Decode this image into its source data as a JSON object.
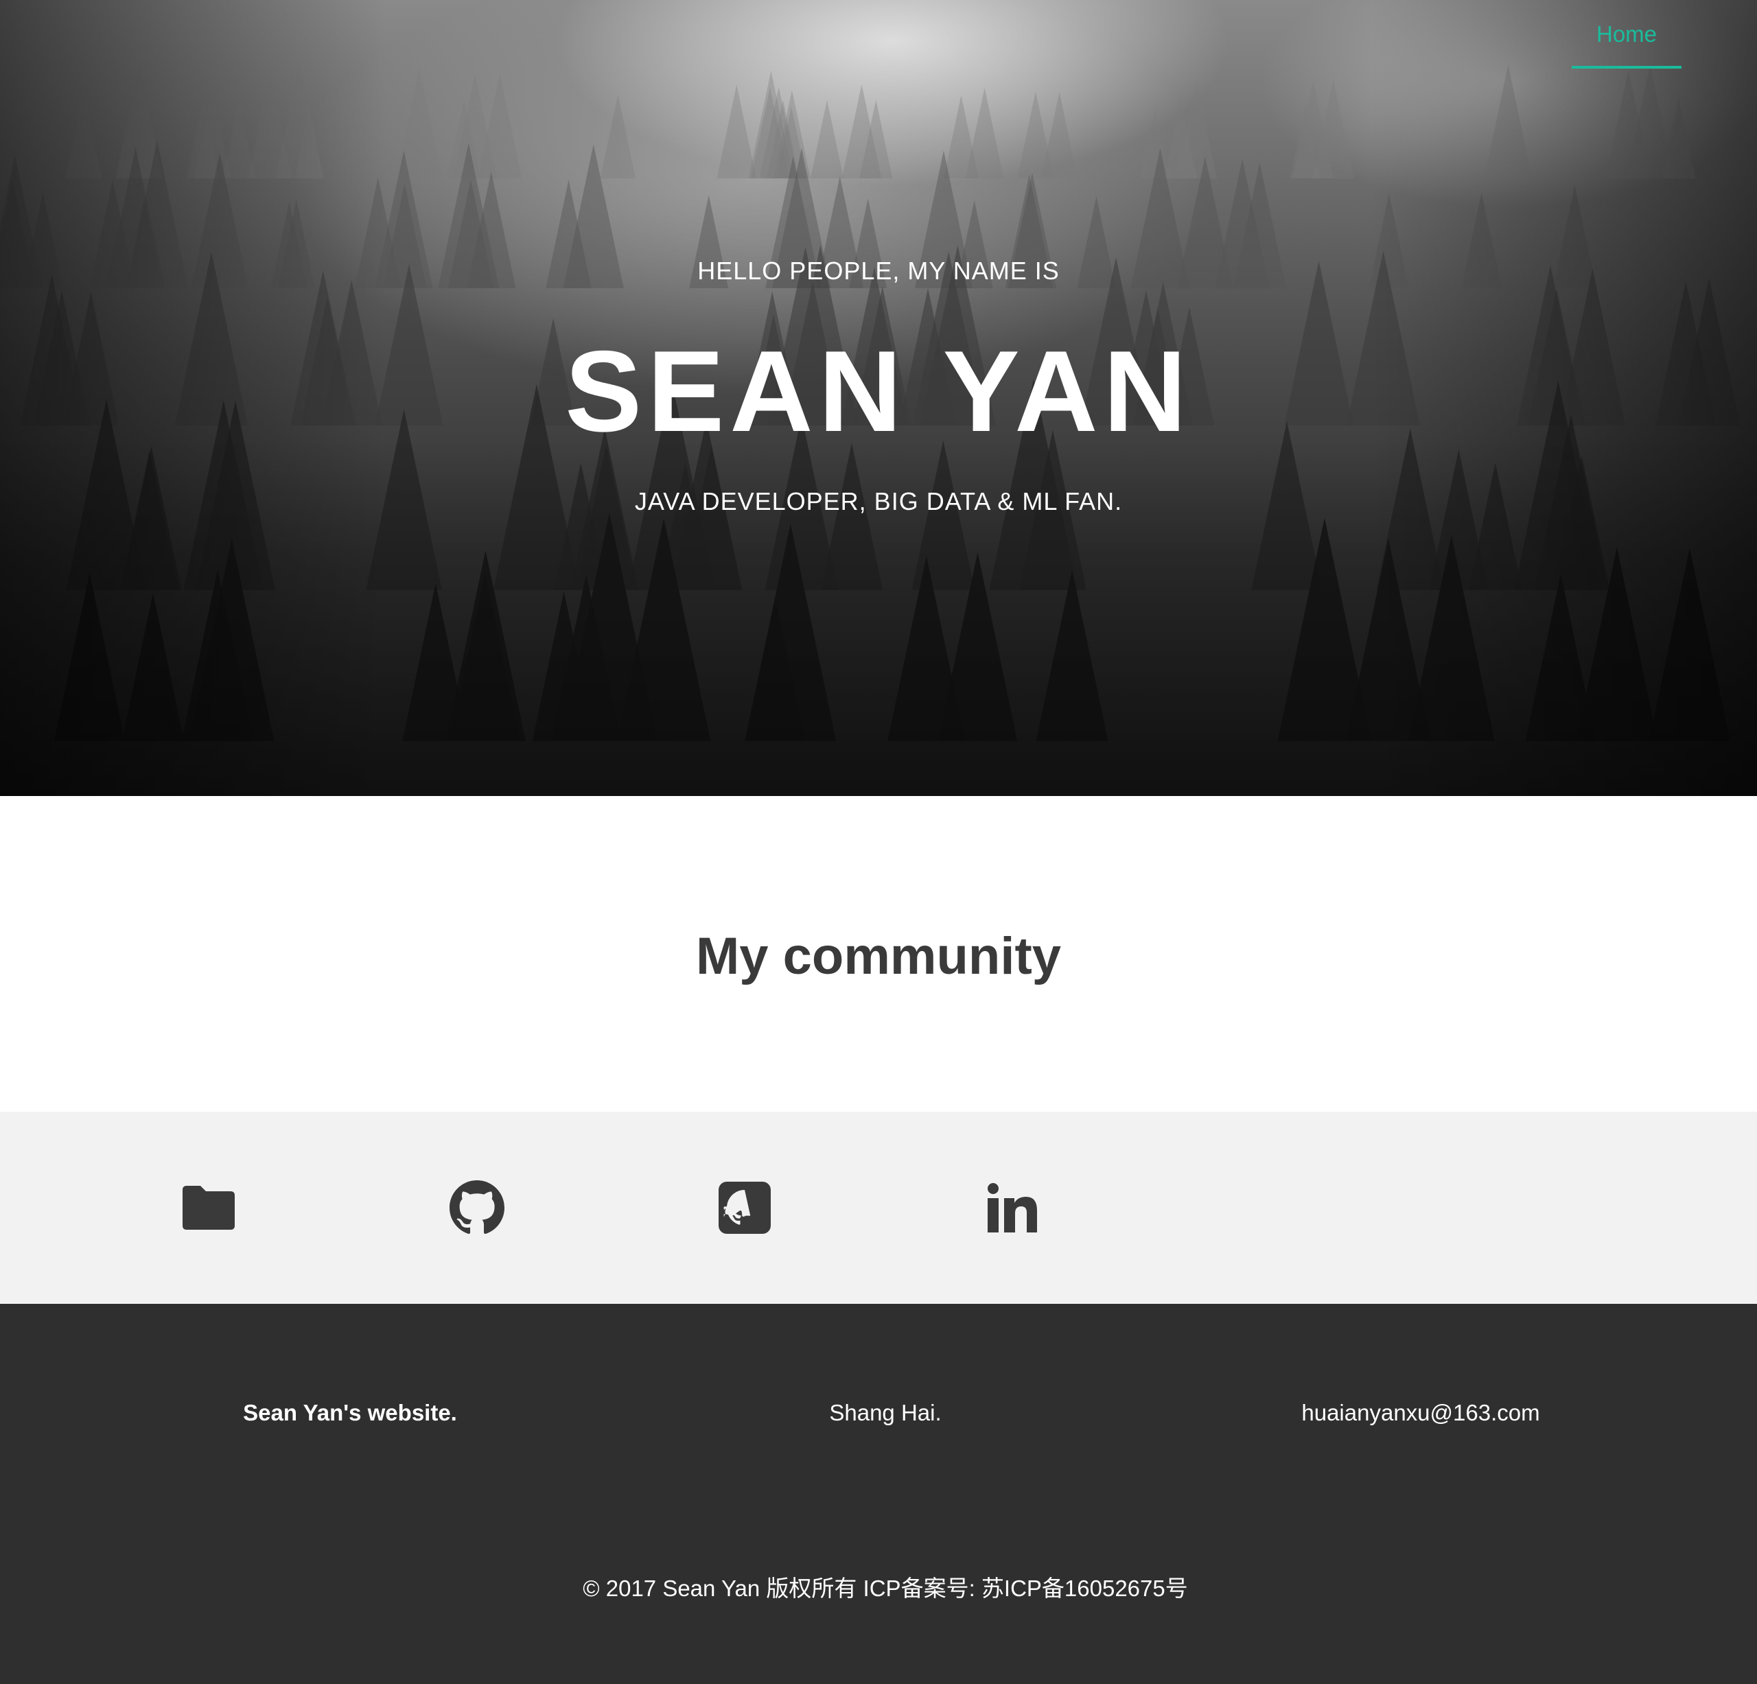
{
  "nav": {
    "home_label": "Home",
    "accent_color": "#1abc9c"
  },
  "hero": {
    "greeting": "HELLO PEOPLE, MY NAME IS",
    "name": "SEAN YAN",
    "tagline": "JAVA DEVELOPER, BIG DATA & ML FAN."
  },
  "community": {
    "title": "My community"
  },
  "social": {
    "icons": [
      "folder-icon",
      "github-icon",
      "github-square-icon",
      "linkedin-icon"
    ],
    "icon_color": "#3a3a3a"
  },
  "footer": {
    "site": "Sean Yan's website.",
    "city": "Shang Hai.",
    "email": "huaianyanxu@163.com",
    "copyright": "© 2017 Sean Yan 版权所有 ICP备案号: 苏ICP备16052675号",
    "background": "#2f2f2f"
  }
}
